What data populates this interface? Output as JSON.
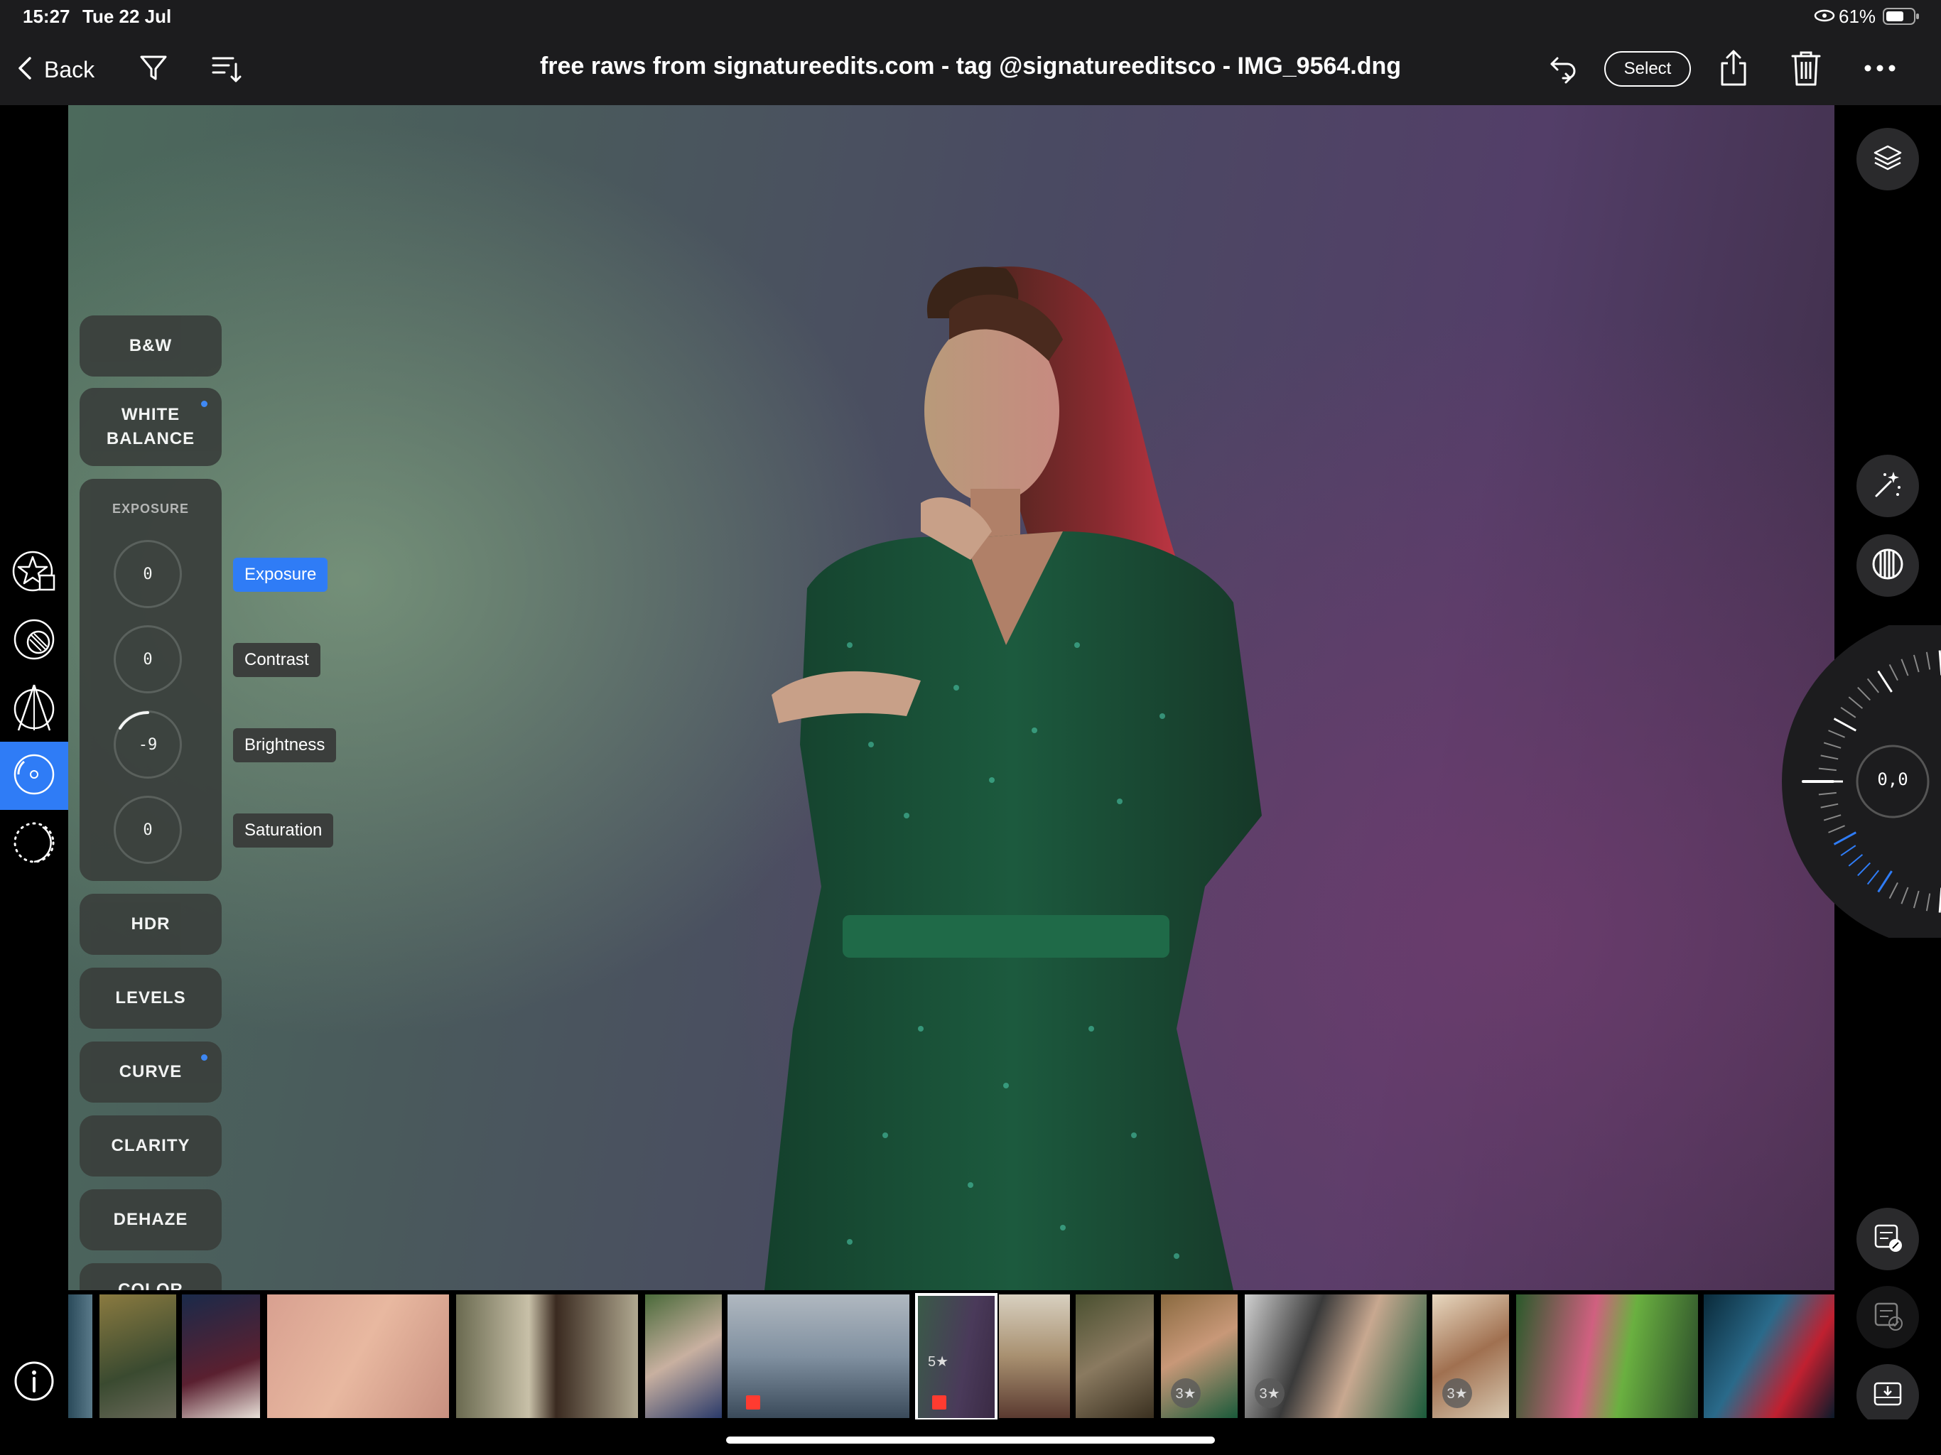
{
  "status": {
    "time": "15:27",
    "date": "Tue 22 Jul",
    "battery": "61%"
  },
  "header": {
    "back_label": "Back",
    "title": "free raws from signatureedits.com - tag @signatureeditsco - IMG_9564.dng",
    "select_label": "Select"
  },
  "tools": {
    "bw": "B&W",
    "white_balance_line1": "WHITE",
    "white_balance_line2": "BALANCE",
    "exposure_header": "EXPOSURE",
    "hdr": "HDR",
    "levels": "LEVELS",
    "curve": "CURVE",
    "clarity": "CLARITY",
    "dehaze": "DEHAZE",
    "color": "COLOR"
  },
  "exposure": {
    "sliders": [
      {
        "label": "Exposure",
        "value": "0",
        "active": true
      },
      {
        "label": "Contrast",
        "value": "0"
      },
      {
        "label": "Brightness",
        "value": "-9"
      },
      {
        "label": "Saturation",
        "value": "0"
      }
    ]
  },
  "wheel": {
    "value": "0,0"
  },
  "filmstrip": {
    "selected_rating": "5★",
    "ratings": [
      "3★",
      "3★",
      "3★"
    ]
  },
  "colors": {
    "accent": "#2f7cf6",
    "flag": "#ff3b30",
    "panel": "#3a3f3c"
  }
}
